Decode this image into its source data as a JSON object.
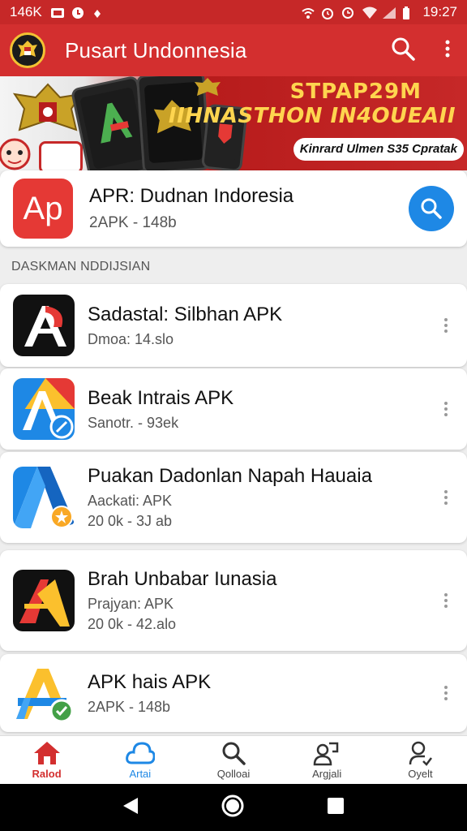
{
  "status_bar": {
    "left_text": "146K",
    "time": "19:27"
  },
  "app_bar": {
    "title": "Pusart Undonnesia",
    "logo_icon": "garuda-emblem-icon",
    "search_icon": "search-icon",
    "menu_icon": "more-vert-icon"
  },
  "banner": {
    "title_line1": "STPAP29M",
    "title_line2": "IIHNASTHON IN4OUEAII",
    "pill_text": "Kinrard Ulmen S35 Cpratak"
  },
  "featured": {
    "icon_text": "Ap",
    "title": "APR: Dudnan Indoresia",
    "subtitle": "2APK - 148b",
    "action_icon": "search-icon"
  },
  "section": {
    "header": "DASKMAN NDDIJSIAN"
  },
  "apps": [
    {
      "name": "Sadastal: Silbhan APK",
      "meta": "Dmoa:  14.slo",
      "meta2": ""
    },
    {
      "name": "Beak Intrais APK",
      "meta": "Sanotr. - 93ek",
      "meta2": ""
    },
    {
      "name": "Puakan Dadonlan Napah Hauaia",
      "meta": "Aackati: APK",
      "meta2": "20 0k  - 3J ab"
    },
    {
      "name": "Brah Unbabar Iunasia",
      "meta": "Prajyan: APK",
      "meta2": "20 0k  - 42.alo"
    },
    {
      "name": "APK hais APK",
      "meta": "2APK - 148b",
      "meta2": ""
    }
  ],
  "bottom_nav": [
    {
      "label": "Ralod",
      "icon": "home-icon"
    },
    {
      "label": "Artai",
      "icon": "cloud-icon"
    },
    {
      "label": "Qolloai",
      "icon": "search-icon"
    },
    {
      "label": "Argjali",
      "icon": "people-icon"
    },
    {
      "label": "Oyelt",
      "icon": "person-icon"
    }
  ],
  "colors": {
    "primary": "#d32f2f",
    "status_bar": "#c62828",
    "accent": "#1e88e5"
  }
}
